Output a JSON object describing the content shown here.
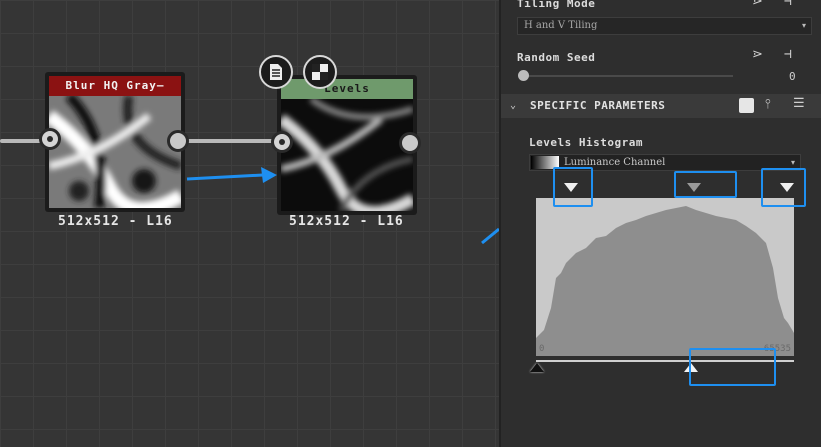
{
  "graph": {
    "nodes": [
      {
        "title": "Blur HQ Gray—",
        "header_color": "#8b1212",
        "caption": "512x512 - L16"
      },
      {
        "title": "Levels",
        "header_color": "#6f9a6c",
        "caption": "512x512 - L16"
      }
    ],
    "top_buttons": [
      "document-icon",
      "checker-icon"
    ]
  },
  "panel": {
    "tiling_mode": {
      "label": "Tiling Mode",
      "value": "H and V Tiling"
    },
    "random_seed": {
      "label": "Random Seed",
      "value": "0"
    },
    "section": {
      "title": "SPECIFIC PARAMETERS"
    },
    "histogram": {
      "label": "Levels Histogram",
      "channel": "Luminance Channel",
      "range_min": "0",
      "range_max": "65535",
      "mid_slider_fraction": 0.6
    }
  },
  "colors": {
    "highlight": "#1e8ff0",
    "panel_bg": "#2e2e2e",
    "graph_bg": "#353535"
  }
}
